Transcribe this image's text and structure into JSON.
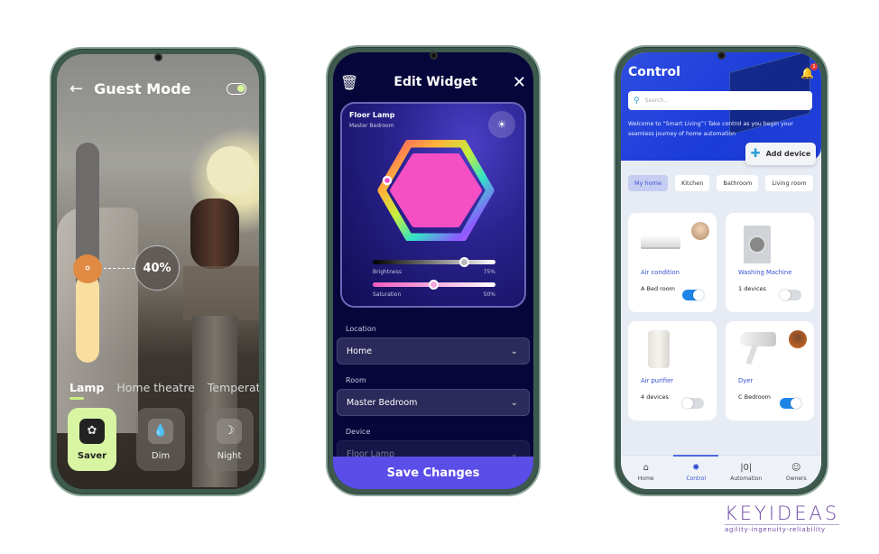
{
  "phone1": {
    "title": "Guest Mode",
    "back_icon": "arrow-left-icon",
    "guest_toggle_on": true,
    "brightness_percent_label": "40%",
    "brightness_fraction": 0.4,
    "tabs": [
      {
        "label": "Lamp",
        "active": true
      },
      {
        "label": "Home theatre",
        "active": false
      },
      {
        "label": "Temperatu",
        "active": false
      }
    ],
    "modes": [
      {
        "label": "Saver",
        "icon": "leaf-icon",
        "active": true
      },
      {
        "label": "Dim",
        "icon": "drop-icon",
        "active": false
      },
      {
        "label": "Night",
        "icon": "moon-cloud-icon",
        "active": false
      }
    ]
  },
  "phone2": {
    "title": "Edit Widget",
    "device_name": "Floor Lamp",
    "device_room": "Master Bedroom",
    "brightness": {
      "label": "Brightness",
      "value": "75%",
      "fraction": 0.75
    },
    "saturation": {
      "label": "Saturation",
      "value": "50%",
      "fraction": 0.5
    },
    "color_hex": "#f54fc4",
    "fields": [
      {
        "label": "Location",
        "value": "Home"
      },
      {
        "label": "Room",
        "value": "Master Bedroom"
      },
      {
        "label": "Device",
        "value": "Floor Lamp"
      }
    ],
    "save_label": "Save Changes",
    "accent": "#5b4de8"
  },
  "phone3": {
    "title": "Control",
    "notification_count": "1",
    "search_placeholder": "Search...",
    "welcome_text": "Welcome to “Smart Living”! Take control as you begin your seamless journey of home automation",
    "add_device_label": "Add device",
    "chips": [
      {
        "label": "My home",
        "active": true
      },
      {
        "label": "Kitchen",
        "active": false
      },
      {
        "label": "Bathroom",
        "active": false
      },
      {
        "label": "Living room",
        "active": false
      }
    ],
    "devices": [
      {
        "name": "Air condition",
        "sub": "A Bed room",
        "on": true,
        "avatar": true
      },
      {
        "name": "Washing Machine",
        "sub": "1 devices",
        "on": false,
        "avatar": false
      },
      {
        "name": "Air purifier",
        "sub": "4 devices",
        "on": false,
        "avatar": false
      },
      {
        "name": "Dyer",
        "sub": "C Bedroom",
        "on": true,
        "avatar": true
      }
    ],
    "nav": [
      {
        "label": "Home",
        "icon": "home-icon",
        "active": false
      },
      {
        "label": "Control",
        "icon": "control-icon",
        "active": true
      },
      {
        "label": "Automation",
        "icon": "automation-icon",
        "active": false
      },
      {
        "label": "Owners",
        "icon": "user-icon",
        "active": false
      }
    ],
    "accent": "#3552cf"
  },
  "brand": {
    "name": "KEYIDEAS",
    "tagline": "agility-ingenuity-reliability"
  }
}
